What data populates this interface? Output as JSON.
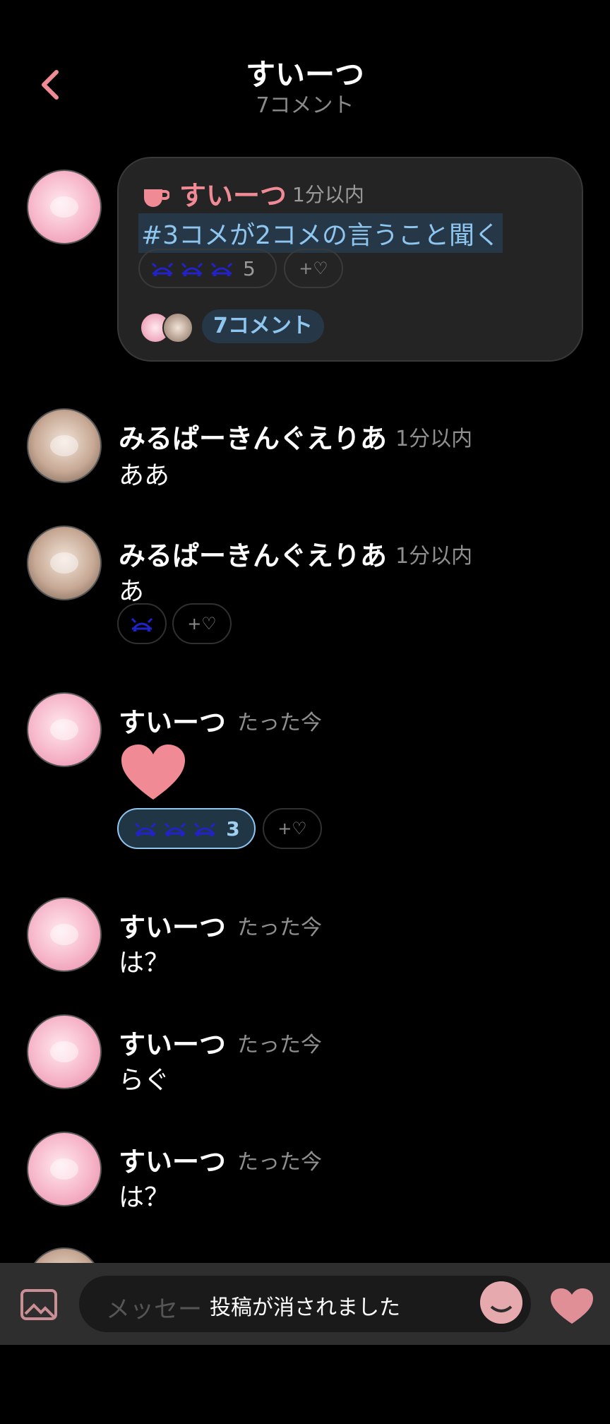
{
  "header": {
    "title": "すいーつ",
    "subtitle": "7コメント"
  },
  "thread": {
    "author": "すいーつ",
    "time": "1分以内",
    "topic": "#3コメが2コメの言うこと聞く",
    "reaction_count": "5",
    "add_reaction": "+♡",
    "comments_chip": "7コメント"
  },
  "comments": [
    {
      "name": "みるぱーきんぐえりあ",
      "time": "1分以内",
      "text": "ああ",
      "avatar": "beige"
    },
    {
      "name": "みるぱーきんぐえりあ",
      "time": "1分以内",
      "text": "あ",
      "avatar": "beige",
      "add_reaction": "+♡"
    },
    {
      "name": "すいーつ",
      "time": "たった今",
      "text": "",
      "avatar": "pink",
      "reaction_count": "3",
      "add_reaction": "+♡"
    },
    {
      "name": "すいーつ",
      "time": "たった今",
      "text": "は？",
      "avatar": "pink"
    },
    {
      "name": "すいーつ",
      "time": "たった今",
      "text": "らぐ",
      "avatar": "pink"
    },
    {
      "name": "すいーつ",
      "time": "たった今",
      "text": "は？",
      "avatar": "pink"
    }
  ],
  "composer": {
    "placeholder": "メッセー",
    "toast": "投稿が消されました"
  },
  "colors": {
    "accent_pink": "#f08a95",
    "link_blue": "#8ec6f0",
    "crab_blue": "#2222cc"
  }
}
